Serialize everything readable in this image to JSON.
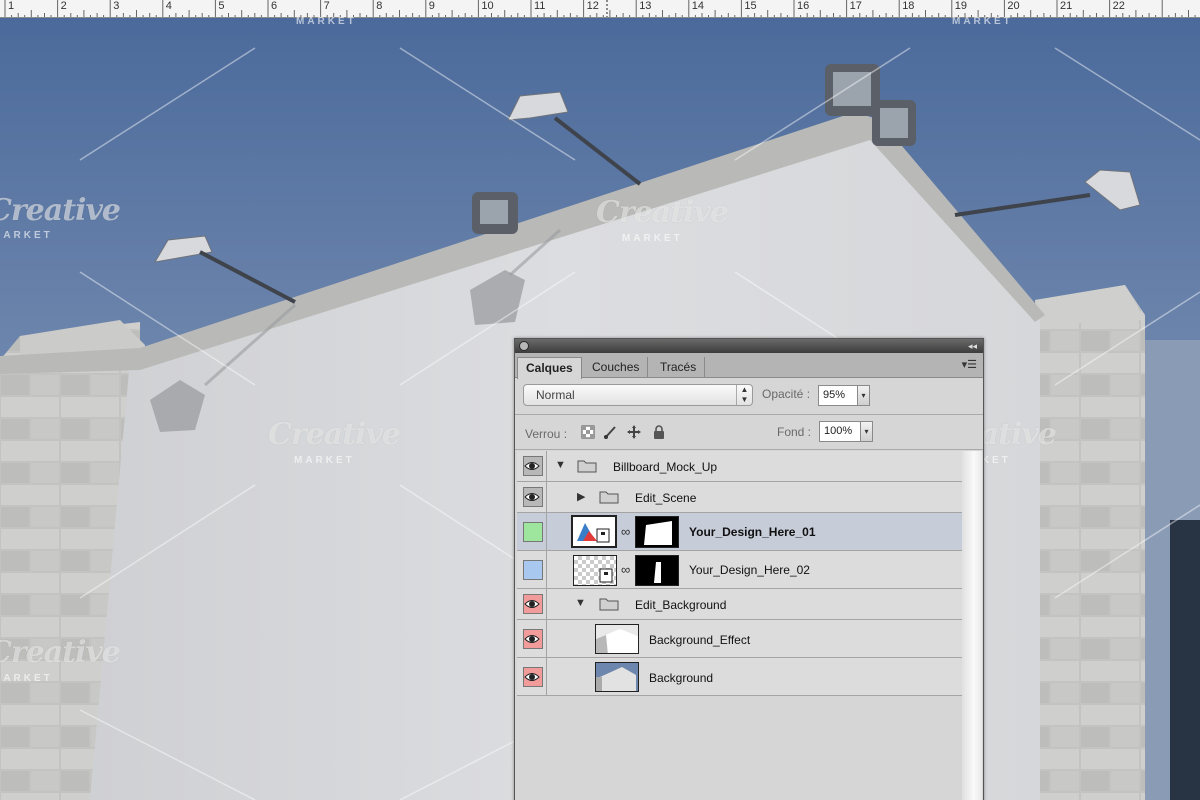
{
  "ruler": {
    "labels": [
      "1",
      "2",
      "3",
      "4",
      "5",
      "6",
      "7",
      "8",
      "9",
      "10",
      "11",
      "12",
      "13",
      "14",
      "15",
      "16",
      "17",
      "18",
      "19",
      "20",
      "21",
      "22"
    ]
  },
  "watermark": {
    "text": "Creative",
    "sub": "MARKET"
  },
  "panel": {
    "tabs": [
      {
        "label": "Calques",
        "active": true
      },
      {
        "label": "Couches",
        "active": false
      },
      {
        "label": "Tracés",
        "active": false
      }
    ],
    "blend_mode": "Normal",
    "opacity_label": "Opacité :",
    "opacity_value": "95%",
    "lock_label": "Verrou :",
    "fill_label": "Fond :",
    "fill_value": "100%",
    "layers": [
      {
        "name": "Billboard_Mock_Up",
        "kind": "group",
        "expanded": true,
        "visible": true,
        "color": "#b8b8b8"
      },
      {
        "name": "Edit_Scene",
        "kind": "group",
        "expanded": false,
        "visible": true,
        "color": "#b8b8b8"
      },
      {
        "name": "Your_Design_Here_01",
        "kind": "smart-object",
        "visible": false,
        "selected": true,
        "color": "#9ee69e"
      },
      {
        "name": "Your_Design_Here_02",
        "kind": "smart-object",
        "visible": false,
        "color": "#a8c8f0"
      },
      {
        "name": "Edit_Background",
        "kind": "group",
        "expanded": true,
        "visible": true,
        "color": "#f29b9b"
      },
      {
        "name": "Background_Effect",
        "kind": "layer",
        "visible": true,
        "color": "#f29b9b"
      },
      {
        "name": "Background",
        "kind": "layer",
        "visible": true,
        "color": "#f29b9b"
      }
    ]
  },
  "colors": {
    "sky": "#7f95b6",
    "wall": "#d4d5d7",
    "stone": "#bdbdbb",
    "panel": "#d6d6d6"
  }
}
